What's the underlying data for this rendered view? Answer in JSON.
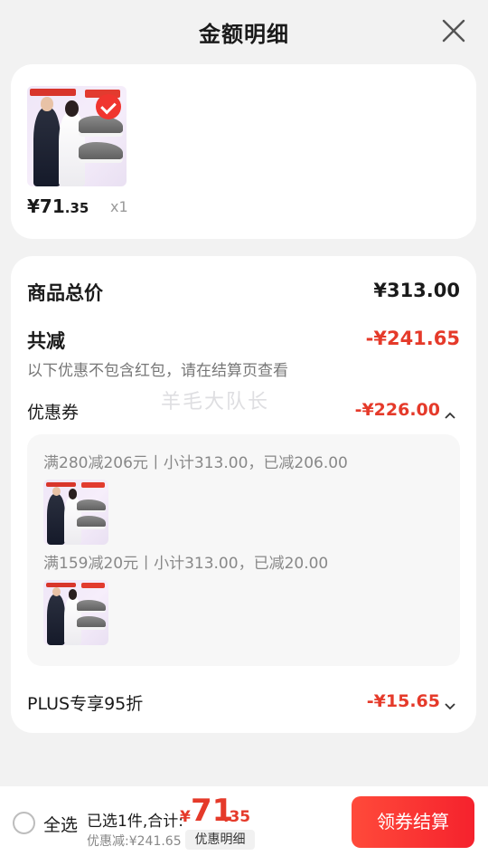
{
  "header": {
    "title": "金额明细"
  },
  "product": {
    "price_int": "¥71",
    "price_dec": ".35",
    "qty": "x1"
  },
  "summary": {
    "total_label": "商品总价",
    "total_value": "¥313.00",
    "discount_label": "共减",
    "discount_value": "-¥241.65",
    "discount_note": "以下优惠不包含红包，请在结算页查看"
  },
  "coupon": {
    "label": "优惠券",
    "value": "-¥226.00",
    "items": [
      {
        "text": "满280减206元丨小计313.00，已减206.00"
      },
      {
        "text": "满159减20元丨小计313.00，已减20.00"
      }
    ]
  },
  "plus": {
    "label": "PLUS专享95折",
    "value": "-¥15.65"
  },
  "watermark": "羊毛大队长",
  "bottom": {
    "select_all": "全选",
    "selected_info": "已选1件,合计:",
    "total_yen": "¥",
    "total_int": "71",
    "total_dec": ".35",
    "saved": "优惠减:¥241.65",
    "detail_tag": "优惠明细",
    "checkout": "领券结算"
  },
  "colors": {
    "accent": "#e53a2a",
    "button": "#f5222d",
    "background": "#f2f2f2"
  }
}
